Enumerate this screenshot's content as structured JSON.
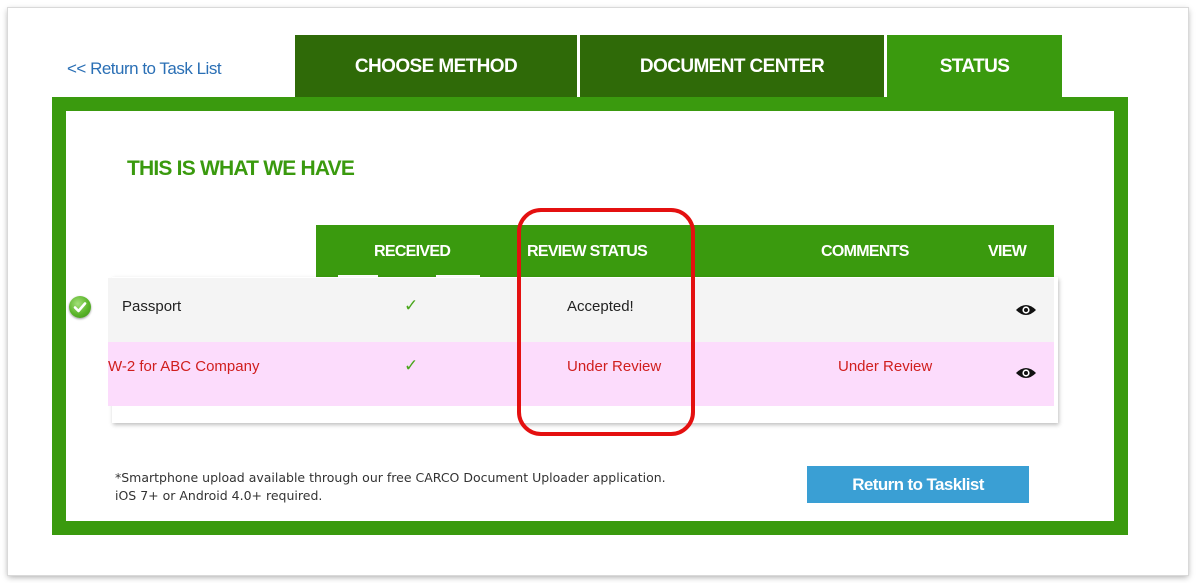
{
  "nav": {
    "return_link": "<< Return to Task List",
    "tabs": [
      {
        "label": "CHOOSE METHOD",
        "active": false
      },
      {
        "label": "DOCUMENT CENTER",
        "active": false
      },
      {
        "label": "STATUS",
        "active": true
      }
    ]
  },
  "section": {
    "title": "THIS IS WHAT WE HAVE"
  },
  "table": {
    "headers": {
      "received": "RECEIVED",
      "review_status": "REVIEW STATUS",
      "comments": "COMMENTS",
      "view": "VIEW"
    },
    "rows": [
      {
        "document": "Passport",
        "received": "✓",
        "review_status": "Accepted!",
        "comments": "",
        "status_icon": "check-circle-icon",
        "view_icon": "eye-icon"
      },
      {
        "document": "W-2 for ABC Company",
        "received": "✓",
        "review_status": "Under Review",
        "comments": "Under Review",
        "view_icon": "eye-icon"
      }
    ]
  },
  "footer": {
    "note_line1": "*Smartphone upload available through our free CARCO Document Uploader application.",
    "note_line2": "iOS 7+ or Android 4.0+ required.",
    "button_label": "Return to Tasklist"
  },
  "colors": {
    "tab_dark": "#2f6a08",
    "accent_green": "#3a9a0e",
    "link_blue": "#2a6fb5",
    "button_blue": "#3a9fd4",
    "alert_red": "#d01e1e",
    "highlight_red": "#e41010",
    "row_pink": "#fcdcfc"
  }
}
